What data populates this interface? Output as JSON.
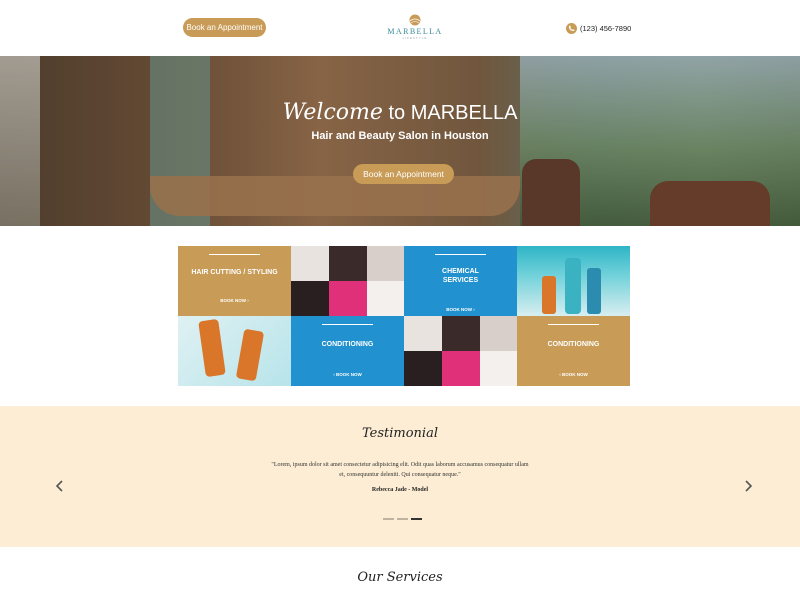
{
  "header": {
    "book_button": "Book an Appointment",
    "logo_name": "MARBELLA",
    "logo_sub": "LIFESTYLE",
    "phone": "(123) 456-7890",
    "accent_color": "#c89b57",
    "phone_icon": "phone-icon"
  },
  "hero": {
    "title_script": "Welcome",
    "title_plain": " to MARBELLA",
    "subtitle": "Hair and Beauty Salon in Houston",
    "button": "Book an Appointment"
  },
  "services_grid": {
    "tiles": [
      {
        "title": "HAIR CUTTING / STYLING",
        "book": "BOOK NOW ›",
        "color": "#c89b57"
      },
      {
        "title": "CHEMICAL SERVICES",
        "book": "BOOK NOW ›",
        "color": "#2191cf"
      },
      {
        "title": "CONDITIONING",
        "book": "‹ BOOK NOW",
        "color": "#2191cf"
      },
      {
        "title": "CONDITIONING",
        "book": "‹ BOOK NOW",
        "color": "#c89b57"
      }
    ]
  },
  "testimonial": {
    "heading": "Testimonial",
    "quote": "\"Lorem, ipsum dolor sit amet consectetur adipisicing elit. Odit quas laborum accusamus consequatur ullam et, consequuntur deleniti. Qui consequatur neque.\"",
    "author": "Rebecca Jade - Model",
    "slide_count": 3,
    "active_slide": 3,
    "background": "#fcedd4"
  },
  "services": {
    "heading": "Our Services"
  }
}
